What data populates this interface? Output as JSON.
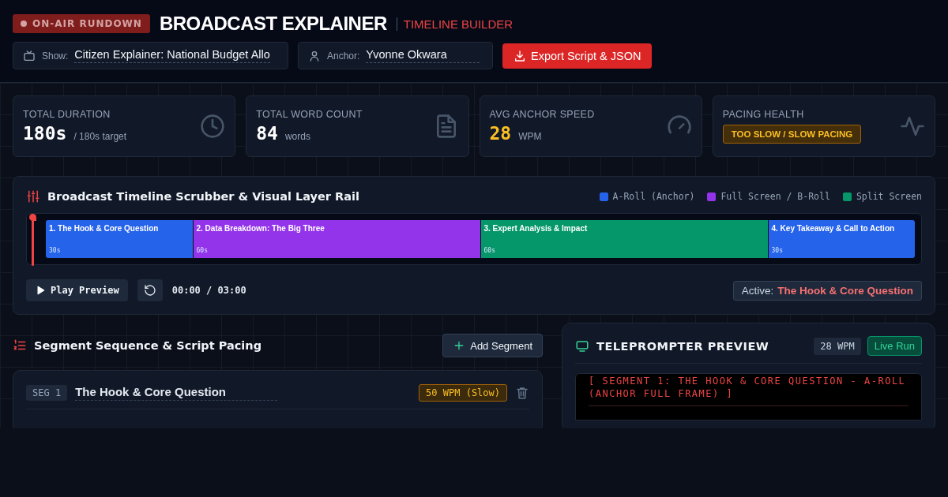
{
  "header": {
    "badge": "ON-AIR RUNDOWN",
    "title": "BROADCAST EXPLAINER",
    "subtitle": "TIMELINE BUILDER",
    "fields": [
      {
        "kind": "show",
        "label": "Show:",
        "value": "Citizen Explainer: National Budget Allo"
      },
      {
        "kind": "anchor",
        "label": "Anchor:",
        "value": "Yvonne Okwara"
      }
    ],
    "export_button": "Export Script & JSON"
  },
  "stats": [
    {
      "kind": "clock",
      "label": "TOTAL DURATION",
      "value": "180s",
      "unit": "/ 180s target"
    },
    {
      "kind": "document",
      "label": "TOTAL WORD COUNT",
      "value": "84",
      "unit": "words"
    },
    {
      "kind": "gauge",
      "label": "AVG ANCHOR SPEED",
      "value": "28",
      "unit": "WPM",
      "color": "#fbbf24"
    },
    {
      "kind": "pulse",
      "label": "PACING HEALTH",
      "badge": "TOO SLOW / SLOW PACING"
    }
  ],
  "timeline": {
    "title": "Broadcast Timeline Scrubber & Visual Layer Rail",
    "legend": [
      {
        "label": "A-Roll (Anchor)",
        "color": "#2563eb"
      },
      {
        "label": "Full Screen / B-Roll",
        "color": "#9333ea"
      },
      {
        "label": "Split Screen",
        "color": "#059669"
      }
    ],
    "segments": [
      {
        "title": "1. The Hook & Core Question",
        "duration": "30s",
        "color": "#2563eb"
      },
      {
        "title": "2. Data Breakdown: The Big Three",
        "duration": "60s",
        "color": "#9333ea"
      },
      {
        "title": "3. Expert Analysis & Impact",
        "duration": "60s",
        "color": "#059669"
      },
      {
        "title": "4. Key Takeaway & Call to Action",
        "duration": "30s",
        "color": "#2563eb"
      }
    ],
    "play_button": "Play Preview",
    "time": "00:00 / 03:00",
    "active_label": "Active:",
    "active_value": "The Hook & Core Question"
  },
  "sequence": {
    "title": "Segment Sequence & Script Pacing",
    "add_button": "Add Segment",
    "cards": [
      {
        "tag": "SEG 1",
        "title": "The Hook & Core Question",
        "pace": "50 WPM (Slow)"
      }
    ]
  },
  "teleprompter": {
    "title": "TELEPROMPTER PREVIEW",
    "wpm": "28 WPM",
    "live_button": "Live Run",
    "live": true,
    "cue": "[ SEGMENT 1: THE HOOK & CORE QUESTION - A-ROLL (ANCHOR FULL FRAME) ]"
  }
}
